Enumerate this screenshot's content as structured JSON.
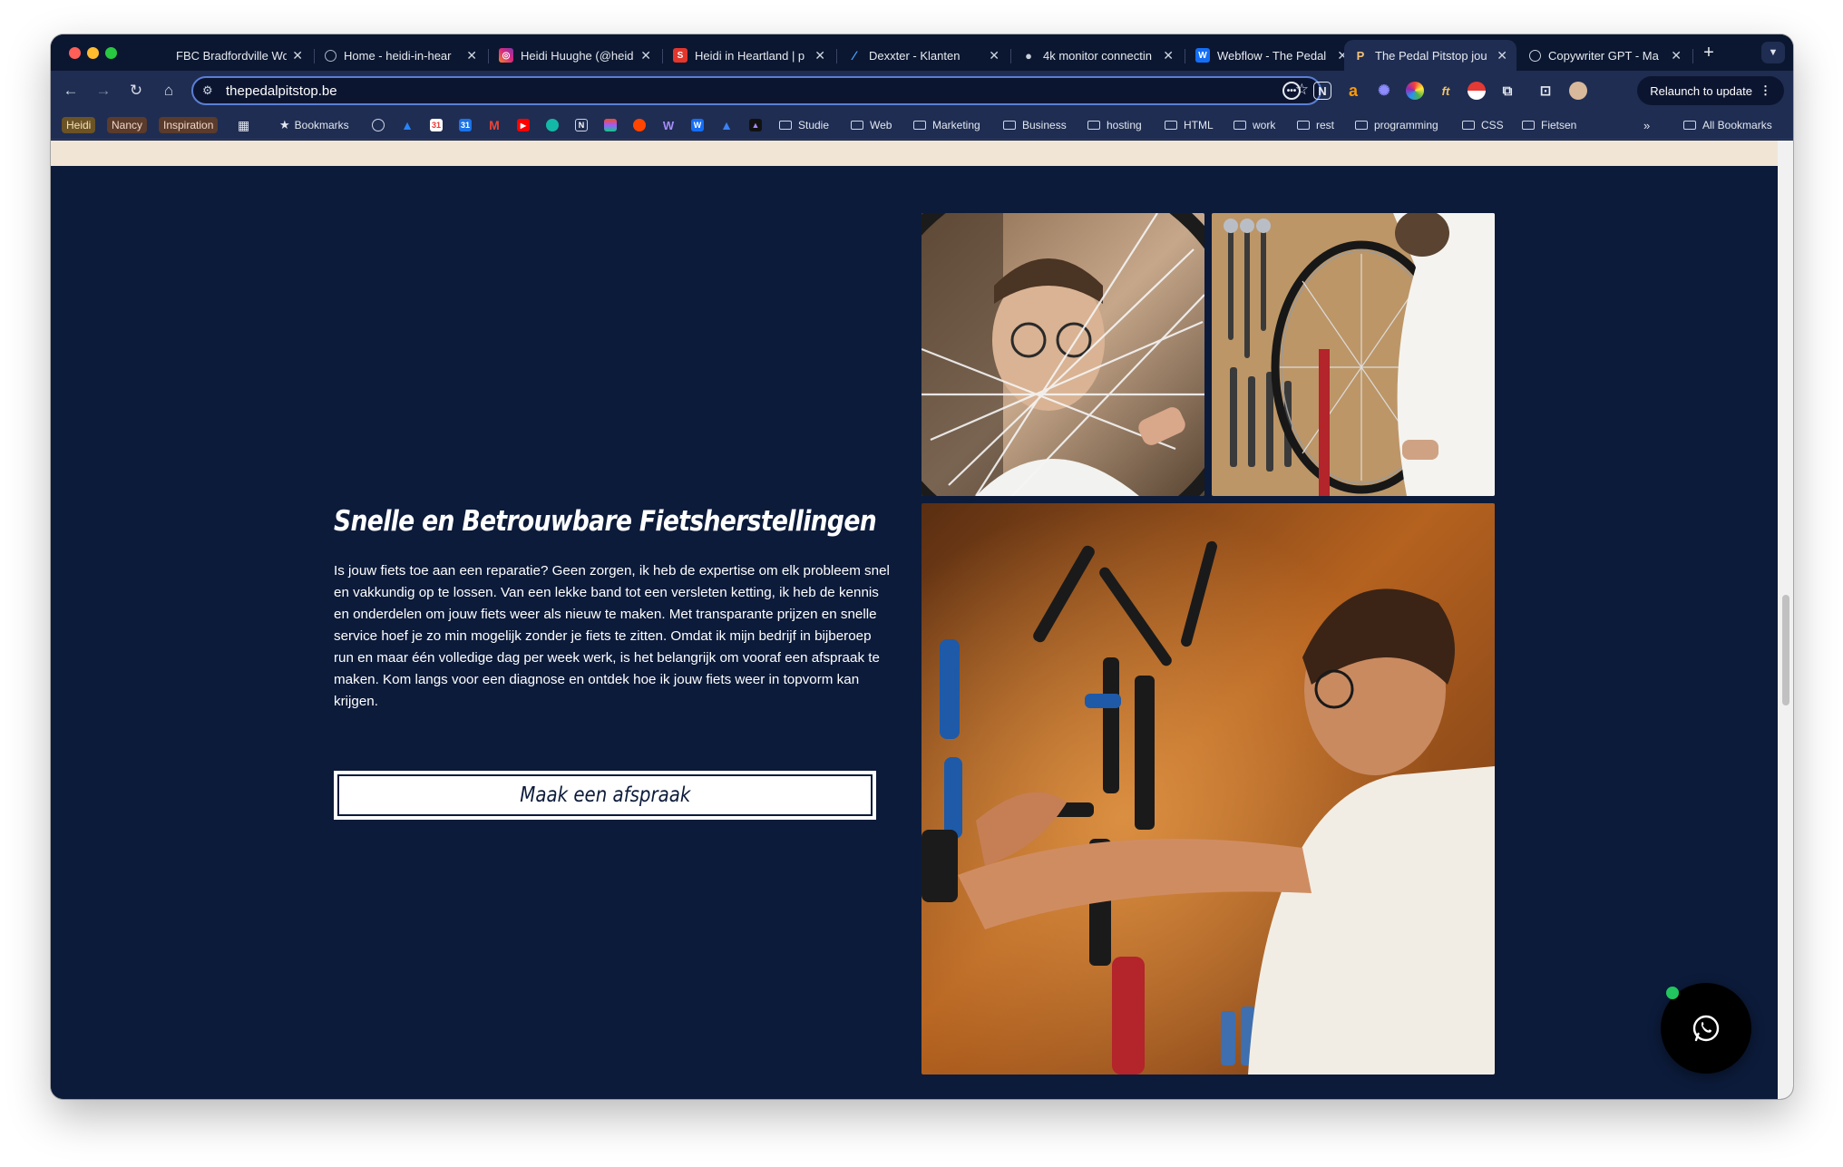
{
  "browser": {
    "tabs": [
      {
        "title": "FBC Bradfordville Wo",
        "favicon": "blank"
      },
      {
        "title": "Home - heidi-in-hear",
        "favicon": "globe-icon"
      },
      {
        "title": "Heidi Huughe (@heid",
        "favicon": "instagram-icon"
      },
      {
        "title": "Heidi in Heartland | p",
        "favicon": "s-icon"
      },
      {
        "title": "Dexxter - Klanten",
        "favicon": "dexxter-icon"
      },
      {
        "title": "4k monitor connectin",
        "favicon": "apple-icon"
      },
      {
        "title": "Webflow - The Pedal",
        "favicon": "webflow-icon"
      },
      {
        "title": "The Pedal Pitstop jou",
        "favicon": "pedal-pitstop-icon",
        "active": true
      },
      {
        "title": "Copywriter GPT - Ma",
        "favicon": "openai-icon"
      }
    ],
    "url": "thepedalpitstop.be",
    "relaunch_label": "Relaunch to update",
    "bookmarks_chips": [
      "Heidi",
      "Nancy",
      "Inspiration"
    ],
    "bookmarks_label": "Bookmarks",
    "bookmark_folders": [
      "Studie",
      "Web",
      "Marketing",
      "Business",
      "hosting",
      "HTML",
      "work",
      "rest",
      "programming",
      "CSS",
      "Fietsen"
    ],
    "all_bookmarks_label": "All Bookmarks"
  },
  "section": {
    "heading": "Snelle en Betrouwbare Fietsherstellingen",
    "body": "Is jouw fiets toe aan een reparatie? Geen zorgen, ik heb de expertise om elk probleem snel en vakkundig op te lossen. Van een lekke band tot een versleten ketting, ik heb de kennis en onderdelen om jouw fiets weer als nieuw te maken. Met transparante prijzen en snelle service hoef je zo min mogelijk zonder je fiets te zitten. Omdat ik mijn bedrijf in bijberoep run en maar één volledige dag per week werk, is het belangrijk om vooraf een afspraak te maken. Kom langs voor een diagnose en ontdek hoe ik jouw fiets weer in topvorm kan krijgen.",
    "cta_label": "Maak een afspraak"
  },
  "colors": {
    "page_bg": "#0c1b3a",
    "beige_strip": "#f1e6d6",
    "accent_green": "#22c55e"
  }
}
